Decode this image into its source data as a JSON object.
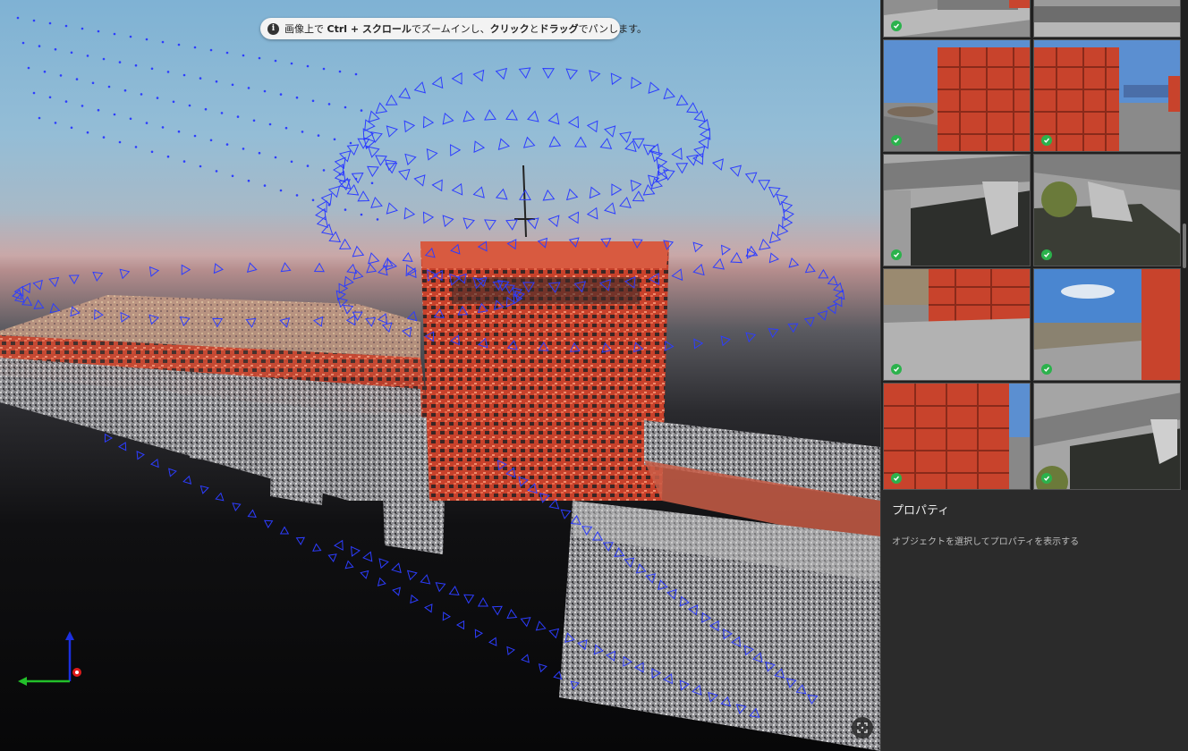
{
  "hint": {
    "icon": "info-icon",
    "part1": "画像上で ",
    "key1": "Ctrl + スクロール",
    "part2": "でズームインし、",
    "key2": "クリック",
    "part3": "と",
    "key3": "ドラッグ",
    "part4": "でパンします。"
  },
  "properties": {
    "title": "プロパティ",
    "empty_message": "オブジェクトを選択してプロパティを表示する"
  },
  "gallery": {
    "thumbnails": [
      {
        "kind": "bridge-top",
        "checked": true
      },
      {
        "kind": "bridge-top-2",
        "checked": false
      },
      {
        "kind": "gate-front-left",
        "checked": true
      },
      {
        "kind": "gate-front-right",
        "checked": true
      },
      {
        "kind": "bridge-corner",
        "checked": true
      },
      {
        "kind": "bridge-tree",
        "checked": true
      },
      {
        "kind": "gate-side-walk",
        "checked": true
      },
      {
        "kind": "sky-riverbank",
        "checked": true
      },
      {
        "kind": "gate-front-close",
        "checked": true
      },
      {
        "kind": "bridge-water",
        "checked": true
      }
    ]
  },
  "colors": {
    "accent_check": "#2bb24c",
    "camera_frustum": "#2d3dff",
    "gate_red": "#d8452e"
  }
}
